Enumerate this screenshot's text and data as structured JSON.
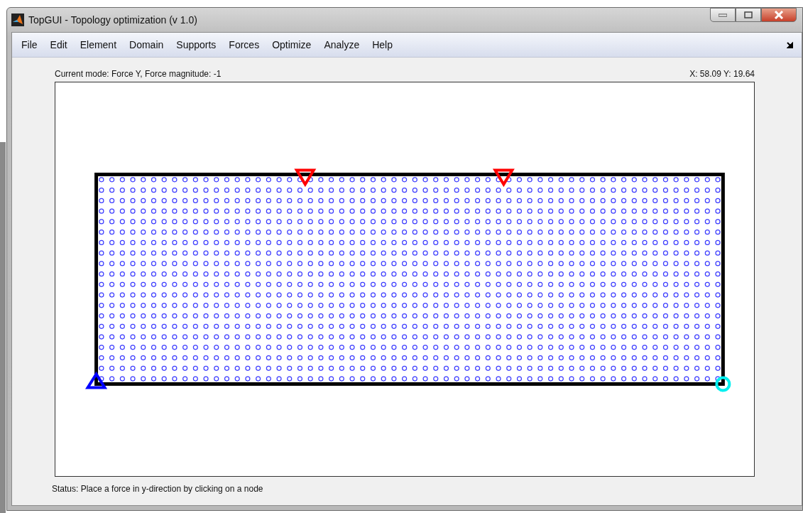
{
  "window": {
    "title": "TopGUI - Topology optimization (v 1.0)"
  },
  "menu": [
    "File",
    "Edit",
    "Element",
    "Domain",
    "Supports",
    "Forces",
    "Optimize",
    "Analyze",
    "Help"
  ],
  "mode_label": "Current mode: Force Y, Force magnitude: -1",
  "cursor_position": "X: 58.09  Y: 19.64",
  "status": "Status: Place a force in y-direction by clicking on a node"
}
